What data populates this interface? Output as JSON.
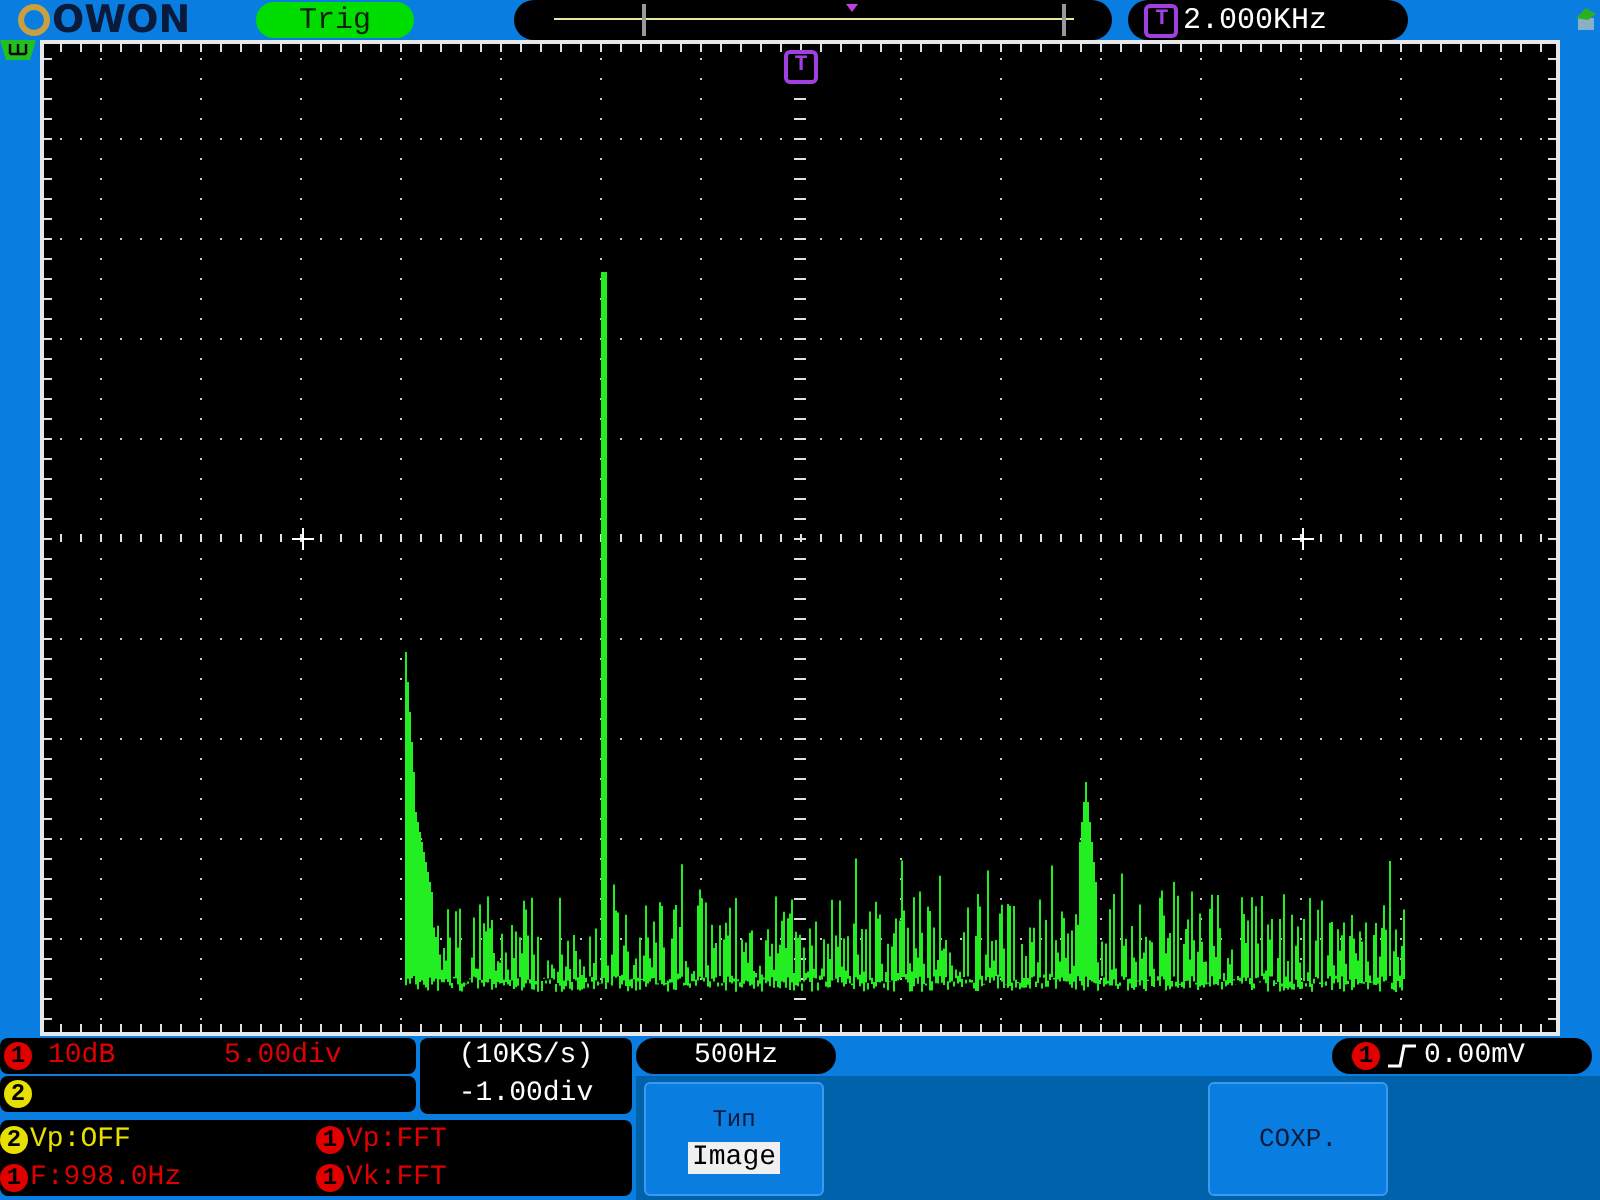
{
  "header": {
    "logo": "OWON",
    "trigger_status": "Trig",
    "marker": "T",
    "trigger_frequency": "2.000KHz"
  },
  "screen": {
    "trigger_marker": "T"
  },
  "channels": [
    {
      "number": "1",
      "color": "#e00000",
      "scale": "10dB",
      "position": "5.00div"
    },
    {
      "number": "2",
      "color": "#e8e000"
    }
  ],
  "timebase": {
    "rate": "(10KS/s)",
    "offset": "-1.00div"
  },
  "fft_scale": "500Hz",
  "trigger": {
    "channel": "1",
    "color": "#e00000",
    "level": "0.00mV"
  },
  "measurements": [
    {
      "channel": "2",
      "color": "#e8e000",
      "text": "Vp:OFF"
    },
    {
      "channel": "1",
      "color": "#e00000",
      "text": "Vp:FFT"
    },
    {
      "channel": "1",
      "color": "#e00000",
      "text": "F:998.0Hz"
    },
    {
      "channel": "1",
      "color": "#e00000",
      "text": "Vk:FFT"
    }
  ],
  "menu": [
    {
      "kind": "option",
      "title": "Тип",
      "value": "Image"
    },
    {
      "kind": "empty"
    },
    {
      "kind": "empty"
    },
    {
      "kind": "button",
      "label": "COXP."
    },
    {
      "kind": "empty"
    }
  ]
}
